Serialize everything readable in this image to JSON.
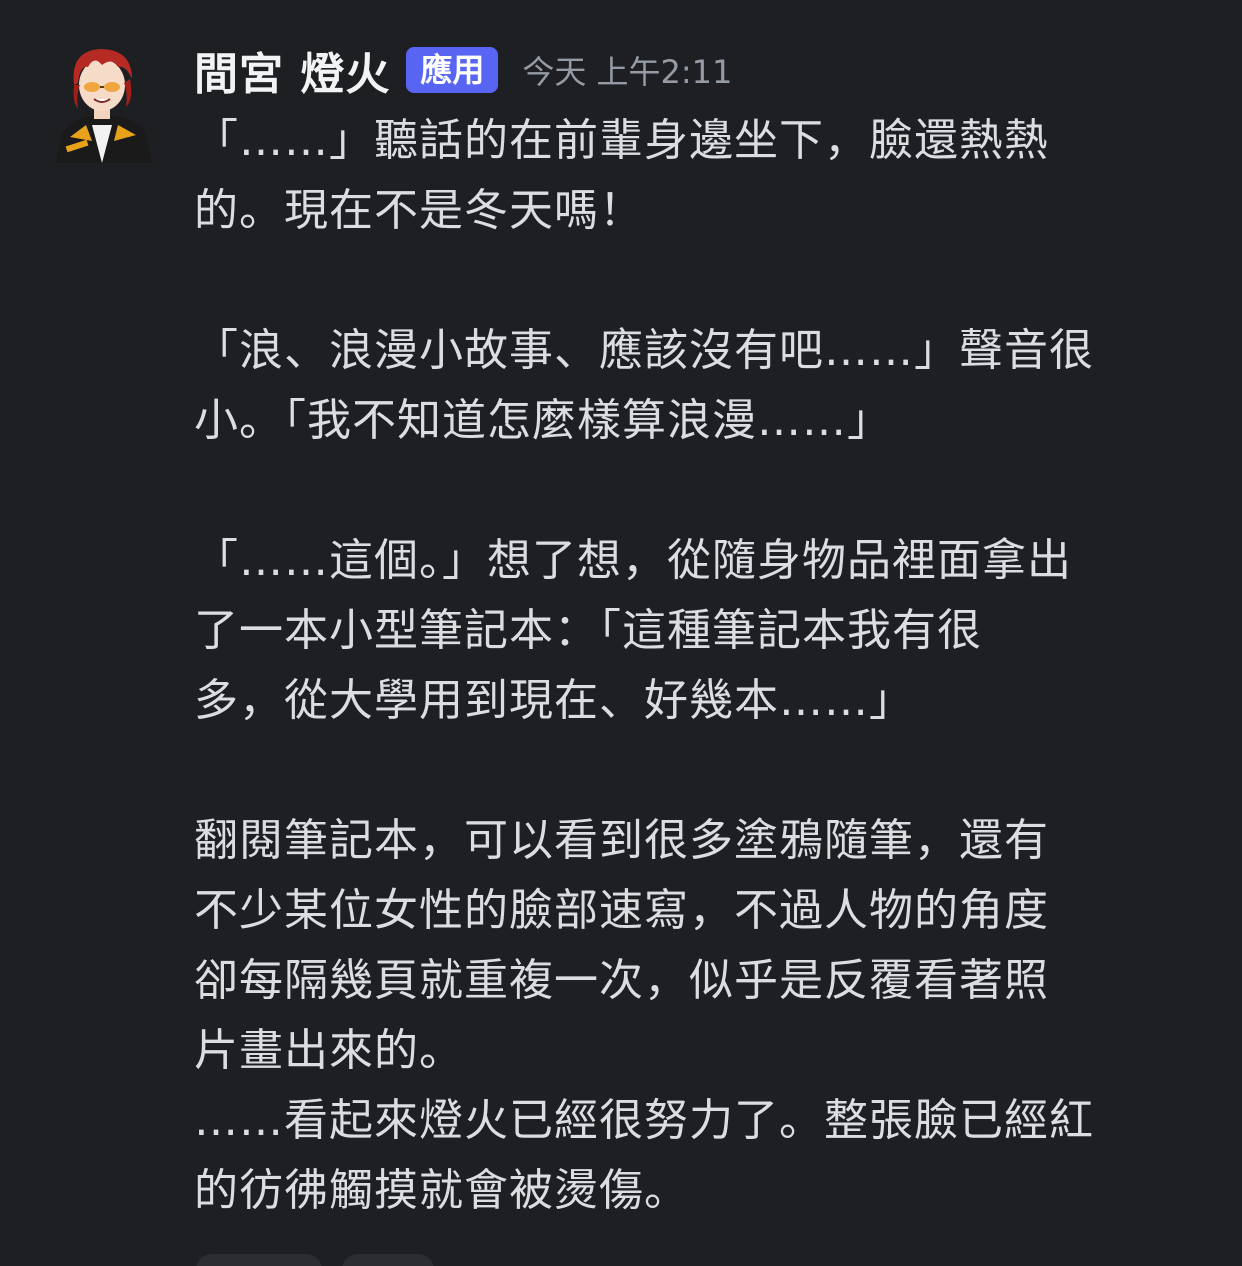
{
  "message": {
    "author": "間宮 燈火",
    "badge": "應用",
    "timestamp": "今天 上午2:11",
    "lines": [
      "「……」聽話的在前輩身邊坐下，臉還熱熱",
      "的。現在不是冬天嗎！",
      "",
      "「浪、浪漫小故事、應該沒有吧……」聲音很",
      "小。「我不知道怎麼樣算浪漫……」",
      "",
      "「……這個。」想了想，從隨身物品裡面拿出",
      "了一本小型筆記本：「這種筆記本我有很",
      "多，從大學用到現在、好幾本……」",
      "",
      "翻閱筆記本，可以看到很多塗鴉隨筆，還有",
      "不少某位女性的臉部速寫，不過人物的角度",
      "卻每隔幾頁就重複一次，似乎是反覆看著照",
      "片畫出來的。",
      "……看起來燈火已經很努力了。整張臉已經紅",
      "的彷彿觸摸就會被燙傷。"
    ]
  },
  "colors": {
    "background": "#1e1f22",
    "badge": "#5865f2",
    "text": "#dbdee1",
    "muted": "#949ba4"
  }
}
